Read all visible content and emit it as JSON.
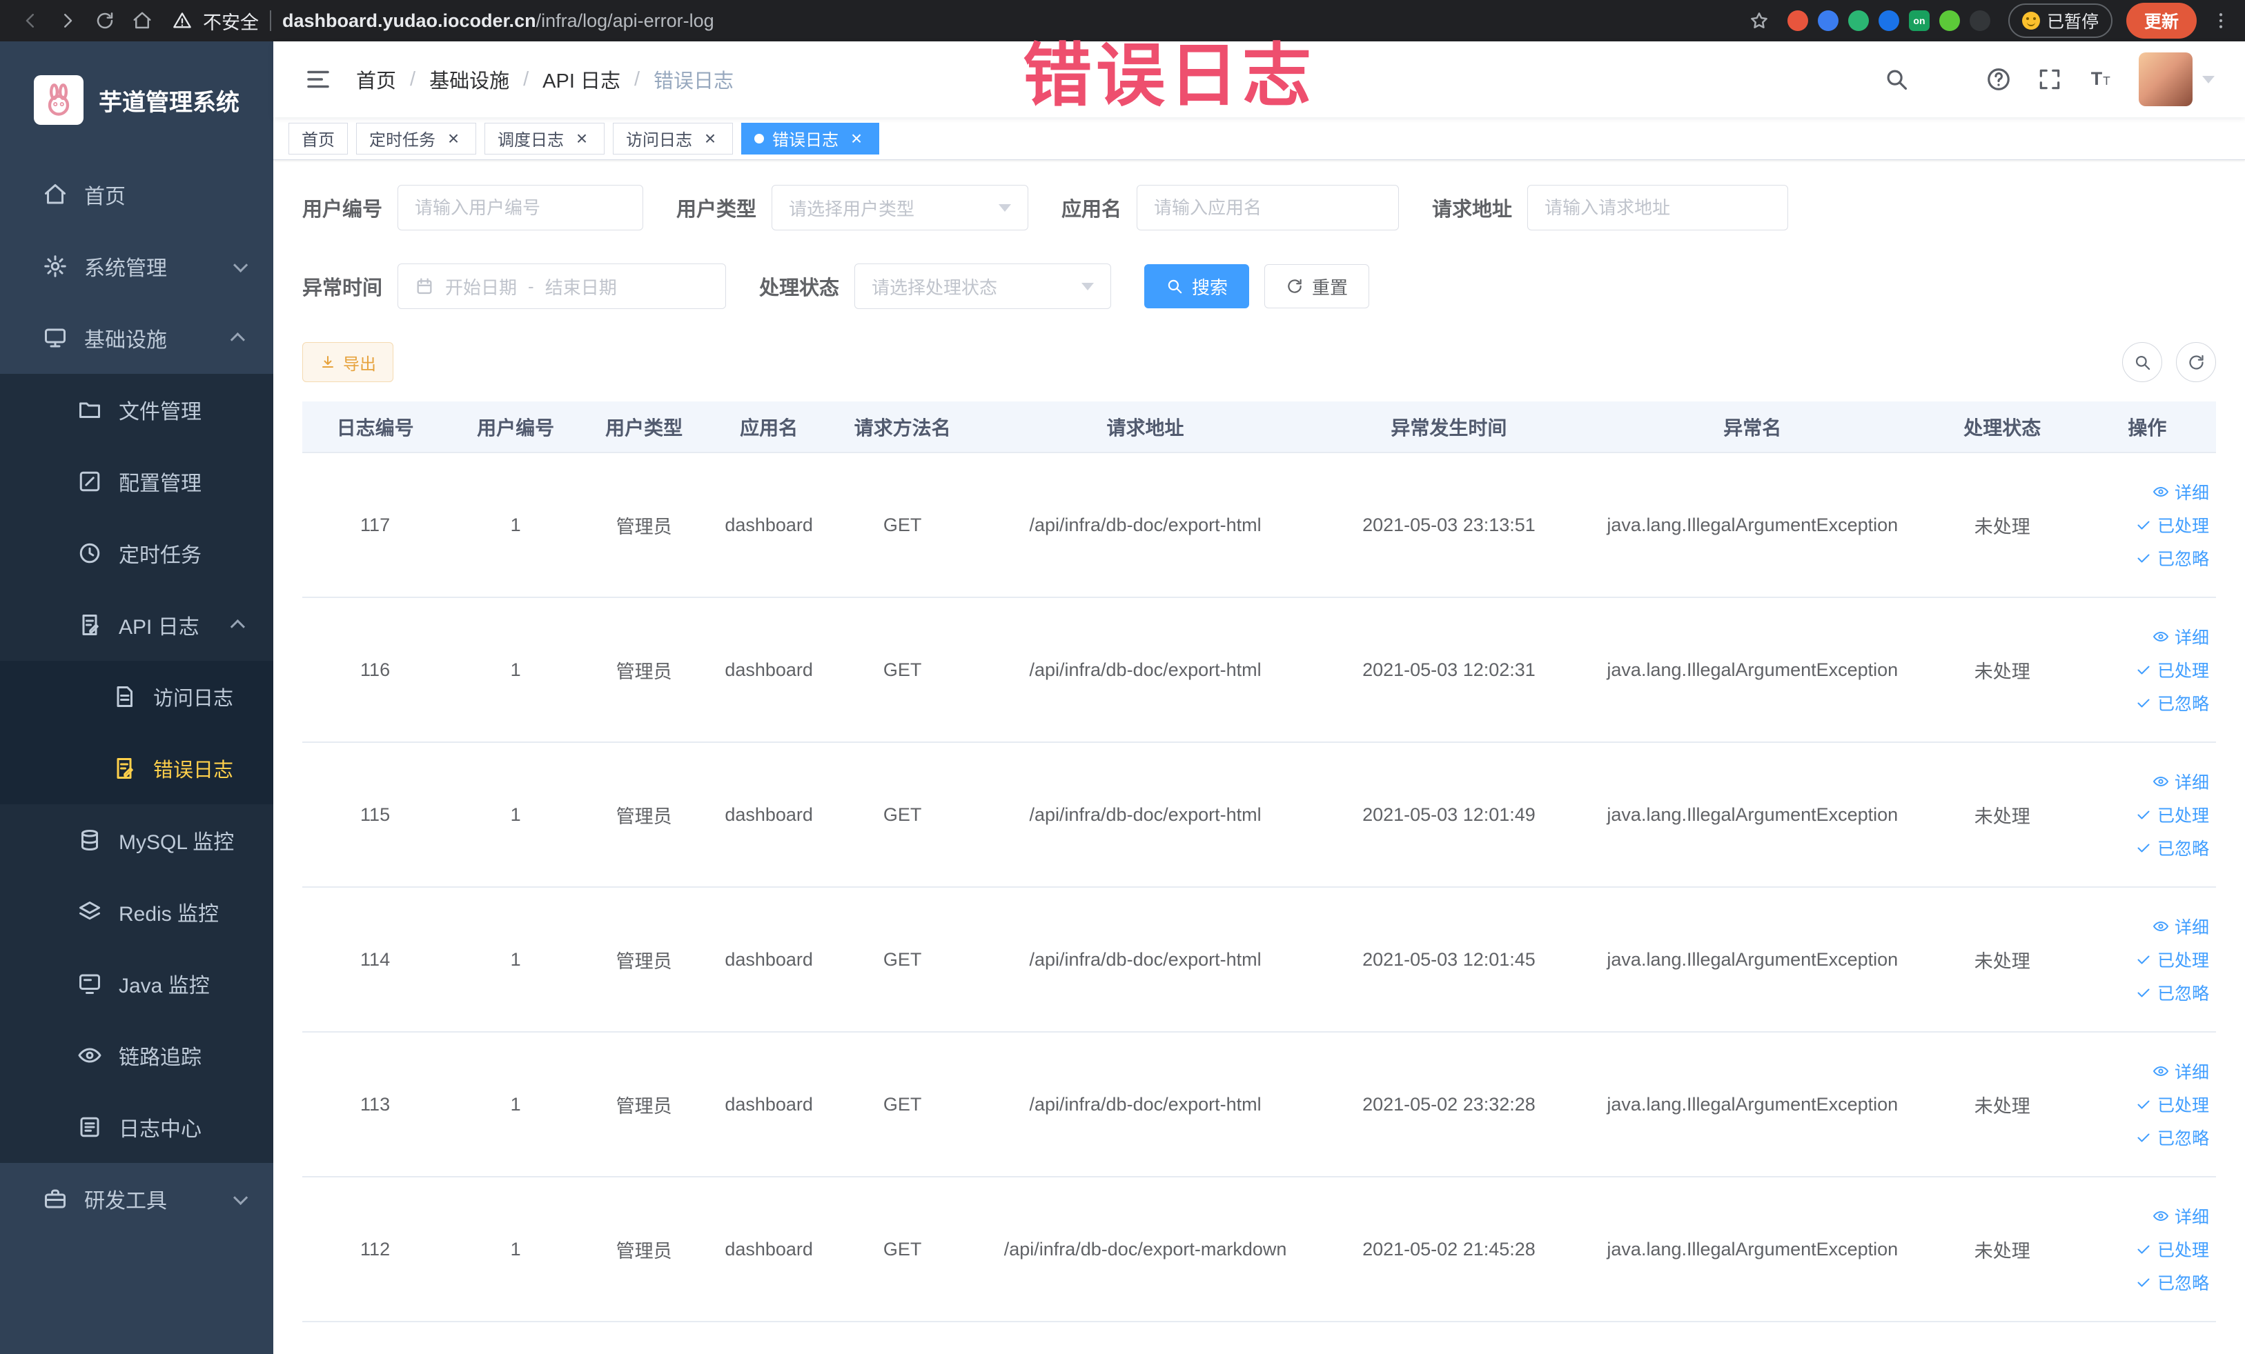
{
  "browser": {
    "security_label": "不安全",
    "url_domain": "dashboard.yudao.iocoder.cn",
    "url_path": "/infra/log/api-error-log",
    "paused_badge": "已暂停",
    "update_button": "更新",
    "extensions": [
      {
        "color": "#e8553d"
      },
      {
        "color": "#3b7df0"
      },
      {
        "color": "#2bb673"
      },
      {
        "color": "#1a73e8"
      },
      {
        "color": "#18a05e",
        "label": "on",
        "shape": "square"
      },
      {
        "color": "#5cc939"
      },
      {
        "color": "#333639"
      }
    ]
  },
  "annotation": {
    "text": "错误日志",
    "color": "#ee4f6e"
  },
  "colors": {
    "primary": "#409EFF",
    "sidebar_bg": "#304156",
    "sidebar_submenu_bg": "#1f2d3d",
    "active_menu_text": "#ffd04b",
    "warning": "#e6a23c",
    "table_header_bg": "#f2f6fc"
  },
  "sidebar": {
    "logo_title": "芋道管理系统",
    "items": [
      {
        "name": "home",
        "label": "首页",
        "icon": "home-icon",
        "level": 0
      },
      {
        "name": "system",
        "label": "系统管理",
        "icon": "gear-icon",
        "level": 0,
        "chevron": "down"
      },
      {
        "name": "infra",
        "label": "基础设施",
        "icon": "monitor-icon",
        "level": 0,
        "chevron": "up"
      },
      {
        "name": "file",
        "label": "文件管理",
        "icon": "folder-icon",
        "level": 1
      },
      {
        "name": "config",
        "label": "配置管理",
        "icon": "edit-icon",
        "level": 1
      },
      {
        "name": "job",
        "label": "定时任务",
        "icon": "clock-icon",
        "level": 1
      },
      {
        "name": "api-log",
        "label": "API 日志",
        "icon": "doc-edit-icon",
        "level": 1,
        "chevron": "up"
      },
      {
        "name": "access-log",
        "label": "访问日志",
        "icon": "doc-icon",
        "level": 2
      },
      {
        "name": "error-log",
        "label": "错误日志",
        "icon": "doc-edit-icon",
        "level": 2,
        "active": true
      },
      {
        "name": "mysql",
        "label": "MySQL 监控",
        "icon": "database-icon",
        "level": 1
      },
      {
        "name": "redis",
        "label": "Redis 监控",
        "icon": "layers-icon",
        "level": 1
      },
      {
        "name": "java",
        "label": "Java 监控",
        "icon": "screen-icon",
        "level": 1
      },
      {
        "name": "trace",
        "label": "链路追踪",
        "icon": "eye-icon",
        "level": 1
      },
      {
        "name": "log-center",
        "label": "日志中心",
        "icon": "list-icon",
        "level": 1
      },
      {
        "name": "dev-tools",
        "label": "研发工具",
        "icon": "briefcase-icon",
        "level": 0,
        "chevron": "down"
      }
    ]
  },
  "header": {
    "breadcrumb": [
      "首页",
      "基础设施",
      "API 日志",
      "错误日志"
    ],
    "icons": [
      "search-icon",
      "github-icon",
      "question-icon",
      "fullscreen-icon",
      "font-size-icon"
    ]
  },
  "tabs": [
    {
      "name": "home",
      "label": "首页",
      "closable": false,
      "active": false
    },
    {
      "name": "job",
      "label": "定时任务",
      "closable": true,
      "active": false
    },
    {
      "name": "job-log",
      "label": "调度日志",
      "closable": true,
      "active": false
    },
    {
      "name": "access-log",
      "label": "访问日志",
      "closable": true,
      "active": false
    },
    {
      "name": "error-log",
      "label": "错误日志",
      "closable": true,
      "active": true
    }
  ],
  "filters": {
    "user_id": {
      "label": "用户编号",
      "placeholder": "请输入用户编号"
    },
    "user_type": {
      "label": "用户类型",
      "placeholder": "请选择用户类型"
    },
    "app_name": {
      "label": "应用名",
      "placeholder": "请输入应用名"
    },
    "request_url": {
      "label": "请求地址",
      "placeholder": "请输入请求地址"
    },
    "exception_time": {
      "label": "异常时间",
      "start_placeholder": "开始日期",
      "separator": "-",
      "end_placeholder": "结束日期"
    },
    "process_status": {
      "label": "处理状态",
      "placeholder": "请选择处理状态"
    },
    "search_button": "搜索",
    "reset_button": "重置"
  },
  "toolbar": {
    "export_button": "导出"
  },
  "table": {
    "columns": [
      {
        "label": "日志编号",
        "name": "log-id"
      },
      {
        "label": "用户编号",
        "name": "user-id"
      },
      {
        "label": "用户类型",
        "name": "user-type"
      },
      {
        "label": "应用名",
        "name": "app-name"
      },
      {
        "label": "请求方法名",
        "name": "method"
      },
      {
        "label": "请求地址",
        "name": "request-url"
      },
      {
        "label": "异常发生时间",
        "name": "exception-time"
      },
      {
        "label": "异常名",
        "name": "exception-name"
      },
      {
        "label": "处理状态",
        "name": "status"
      },
      {
        "label": "操作",
        "name": "actions"
      }
    ],
    "actions": [
      {
        "label": "详细",
        "name": "detail",
        "icon": "eye-icon"
      },
      {
        "label": "已处理",
        "name": "processed",
        "icon": "check-icon"
      },
      {
        "label": "已忽略",
        "name": "ignored",
        "icon": "check-icon"
      }
    ],
    "rows": [
      {
        "id": "117",
        "user_id": "1",
        "user_type": "管理员",
        "app": "dashboard",
        "method": "GET",
        "url": "/api/infra/db-doc/export-html",
        "time": "2021-05-03 23:13:51",
        "exception": "java.lang.IllegalArgumentException",
        "status": "未处理"
      },
      {
        "id": "116",
        "user_id": "1",
        "user_type": "管理员",
        "app": "dashboard",
        "method": "GET",
        "url": "/api/infra/db-doc/export-html",
        "time": "2021-05-03 12:02:31",
        "exception": "java.lang.IllegalArgumentException",
        "status": "未处理"
      },
      {
        "id": "115",
        "user_id": "1",
        "user_type": "管理员",
        "app": "dashboard",
        "method": "GET",
        "url": "/api/infra/db-doc/export-html",
        "time": "2021-05-03 12:01:49",
        "exception": "java.lang.IllegalArgumentException",
        "status": "未处理"
      },
      {
        "id": "114",
        "user_id": "1",
        "user_type": "管理员",
        "app": "dashboard",
        "method": "GET",
        "url": "/api/infra/db-doc/export-html",
        "time": "2021-05-03 12:01:45",
        "exception": "java.lang.IllegalArgumentException",
        "status": "未处理"
      },
      {
        "id": "113",
        "user_id": "1",
        "user_type": "管理员",
        "app": "dashboard",
        "method": "GET",
        "url": "/api/infra/db-doc/export-html",
        "time": "2021-05-02 23:32:28",
        "exception": "java.lang.IllegalArgumentException",
        "status": "未处理"
      },
      {
        "id": "112",
        "user_id": "1",
        "user_type": "管理员",
        "app": "dashboard",
        "method": "GET",
        "url": "/api/infra/db-doc/export-markdown",
        "time": "2021-05-02 21:45:28",
        "exception": "java.lang.IllegalArgumentException",
        "status": "未处理"
      }
    ]
  }
}
